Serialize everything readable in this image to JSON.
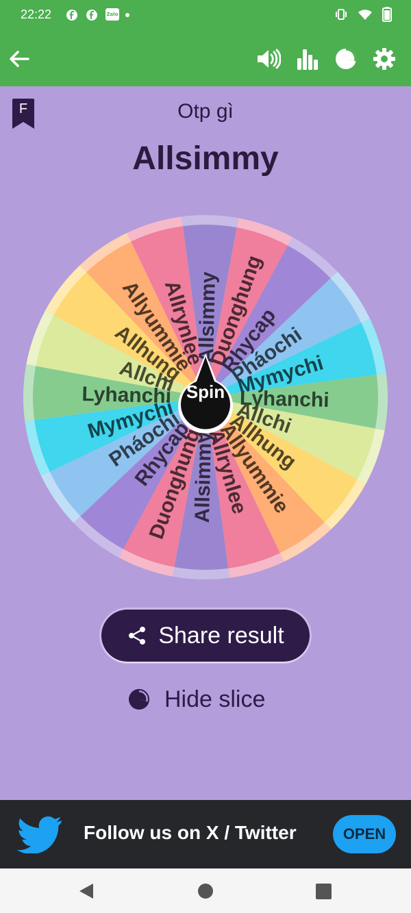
{
  "status_bar": {
    "time": "22:22",
    "zalo_label": "Zalo"
  },
  "header": {
    "back_icon": "arrow-left-icon",
    "actions": [
      "volume-icon",
      "bar-chart-icon",
      "pie-chart-icon",
      "gear-icon"
    ]
  },
  "main": {
    "bookmark_letter": "F",
    "wheel_title": "Otp gì",
    "result": "Allsimmy",
    "spin_label": "Spin",
    "slices": [
      {
        "label": "Allsimmy",
        "color": "#9a86d0"
      },
      {
        "label": "Duonghung",
        "color": "#ef7f9c"
      },
      {
        "label": "Rhycap",
        "color": "#9f86d6"
      },
      {
        "label": "Pháochi",
        "color": "#8fc3f0"
      },
      {
        "label": "Mymychi",
        "color": "#3fd6ee"
      },
      {
        "label": "Lyhanchi",
        "color": "#86cc8f"
      },
      {
        "label": "Allchi",
        "color": "#dcea9d"
      },
      {
        "label": "Allhung",
        "color": "#fdd873"
      },
      {
        "label": "Allyummie",
        "color": "#ffae74"
      },
      {
        "label": "Allrynlee",
        "color": "#ef7f9c"
      },
      {
        "label": "Allsimmy",
        "color": "#9a86d0"
      },
      {
        "label": "Duonghung",
        "color": "#ef7f9c"
      },
      {
        "label": "Rhycap",
        "color": "#9f86d6"
      },
      {
        "label": "Pháochi",
        "color": "#8fc3f0"
      },
      {
        "label": "Mymychi",
        "color": "#3fd6ee"
      },
      {
        "label": "Lyhanchi",
        "color": "#86cc8f"
      },
      {
        "label": "Allchi",
        "color": "#dcea9d"
      },
      {
        "label": "Allhung",
        "color": "#fdd873"
      },
      {
        "label": "Allyummie",
        "color": "#ffae74"
      },
      {
        "label": "Allrynlee",
        "color": "#ef7f9c"
      }
    ],
    "share_label": "Share result",
    "hide_slice_label": "Hide slice"
  },
  "ad": {
    "text": "Follow us on X / Twitter",
    "open_label": "OPEN"
  },
  "colors": {
    "primary": "#4caf50",
    "background": "#b39ddb",
    "dark_text": "#2b1b3d",
    "button": "#2e1b48",
    "twitter_blue": "#1da1f2"
  }
}
